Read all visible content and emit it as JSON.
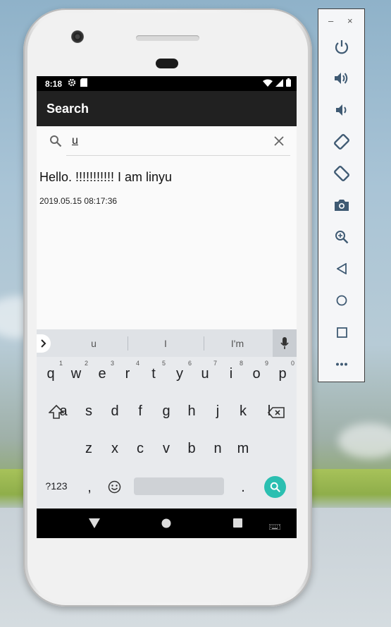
{
  "status_bar": {
    "time": "8:18"
  },
  "app_bar": {
    "title": "Search"
  },
  "search": {
    "query": "u"
  },
  "result": {
    "message": "Hello.  !!!!!!!!!!! I am linyu",
    "timestamp": "2019.05.15 08:17:36"
  },
  "keyboard": {
    "suggestions": [
      "u",
      "I",
      "I'm"
    ],
    "row1": [
      {
        "k": "q",
        "n": "1"
      },
      {
        "k": "w",
        "n": "2"
      },
      {
        "k": "e",
        "n": "3"
      },
      {
        "k": "r",
        "n": "4"
      },
      {
        "k": "t",
        "n": "5"
      },
      {
        "k": "y",
        "n": "6"
      },
      {
        "k": "u",
        "n": "7"
      },
      {
        "k": "i",
        "n": "8"
      },
      {
        "k": "o",
        "n": "9"
      },
      {
        "k": "p",
        "n": "0"
      }
    ],
    "row2": [
      "a",
      "s",
      "d",
      "f",
      "g",
      "h",
      "j",
      "k",
      "l"
    ],
    "row3": [
      "z",
      "x",
      "c",
      "v",
      "b",
      "n",
      "m"
    ],
    "symbols_label": "?123",
    "comma": ",",
    "period": "."
  },
  "emulator_panel": {
    "minimize": "–",
    "close": "×",
    "buttons": [
      "power-icon",
      "volume-up-icon",
      "volume-down-icon",
      "rotate-left-icon",
      "rotate-right-icon",
      "camera-icon",
      "zoom-icon",
      "back-icon",
      "home-icon",
      "overview-icon",
      "more-icon"
    ]
  },
  "colors": {
    "appbar": "#212121",
    "accent": "#2bbfb1",
    "statusbar": "#000000"
  }
}
